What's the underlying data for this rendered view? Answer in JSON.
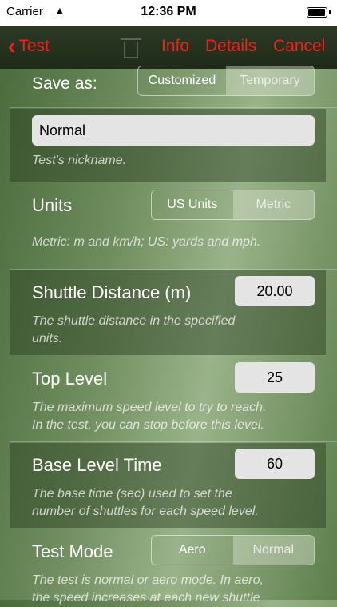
{
  "status": {
    "carrier": "Carrier",
    "time": "12:36 PM"
  },
  "nav": {
    "back_label": "Test",
    "info_label": "Info",
    "details_label": "Details",
    "cancel_label": "Cancel"
  },
  "save_as": {
    "label": "Save as:",
    "options": [
      "Customized",
      "Temporary"
    ]
  },
  "nickname": {
    "value": "Normal",
    "desc": "Test's nickname."
  },
  "units": {
    "label": "Units",
    "options": [
      "US Units",
      "Metric"
    ],
    "selected": "US Units",
    "desc": "Metric: m and km/h; US: yards and mph."
  },
  "shuttle": {
    "label": "Shuttle Distance (m)",
    "value": "20.00",
    "desc_line1": "The shuttle distance in the specified",
    "desc_line2": "units."
  },
  "top_level": {
    "label": "Top Level",
    "value": "25",
    "desc_line1": "The maximum speed level to try to reach.",
    "desc_line2": "In the test, you can stop before this level."
  },
  "base_time": {
    "label": "Base Level Time",
    "value": "60",
    "desc_line1": "The base time (sec) used to set the",
    "desc_line2": "number of shuttles for each speed level."
  },
  "test_mode": {
    "label": "Test Mode",
    "options": [
      "Aero",
      "Normal"
    ],
    "selected": "Aero",
    "desc_line1": "The test is normal or aero mode. In aero,",
    "desc_line2": "the speed increases at each new shuttle"
  }
}
